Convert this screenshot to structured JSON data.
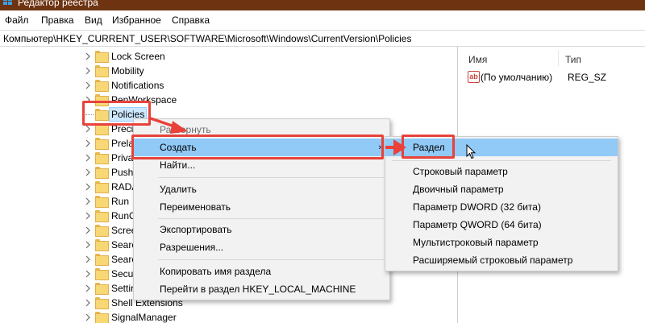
{
  "window": {
    "title": "Редактор реестра"
  },
  "menubar": {
    "items": [
      "Файл",
      "Правка",
      "Вид",
      "Избранное",
      "Справка"
    ]
  },
  "address": {
    "path": "Компьютер\\HKEY_CURRENT_USER\\SOFTWARE\\Microsoft\\Windows\\CurrentVersion\\Policies"
  },
  "tree": {
    "items": [
      {
        "label": "Lock Screen"
      },
      {
        "label": "Mobility"
      },
      {
        "label": "Notifications"
      },
      {
        "label": "PenWorkspace"
      },
      {
        "label": "Policies"
      },
      {
        "label": "Preci"
      },
      {
        "label": "Prela"
      },
      {
        "label": "Priva"
      },
      {
        "label": "Push"
      },
      {
        "label": "RADA"
      },
      {
        "label": "Run"
      },
      {
        "label": "RunO"
      },
      {
        "label": "Scree"
      },
      {
        "label": "Searc"
      },
      {
        "label": "Searc"
      },
      {
        "label": "Secu"
      },
      {
        "label": "Settir"
      },
      {
        "label": "Shell Extensions"
      },
      {
        "label": "SignalManager"
      }
    ]
  },
  "values_pane": {
    "columns": {
      "name": "Имя",
      "type": "Тип"
    },
    "rows": [
      {
        "icon": "ab",
        "name": "(По умолчанию)",
        "type": "REG_SZ"
      }
    ]
  },
  "context_menu": {
    "items": [
      {
        "label": "Развернуть"
      },
      {
        "label": "Создать",
        "arrow": "›"
      },
      {
        "label": "Найти..."
      },
      {
        "label": "Удалить"
      },
      {
        "label": "Переименовать"
      },
      {
        "label": "Экспортировать"
      },
      {
        "label": "Разрешения..."
      },
      {
        "label": "Копировать имя раздела"
      },
      {
        "label": "Перейти в раздел HKEY_LOCAL_MACHINE"
      }
    ]
  },
  "submenu": {
    "items": [
      {
        "label": "Раздел"
      },
      {
        "label": "Строковый параметр"
      },
      {
        "label": "Двоичный параметр"
      },
      {
        "label": "Параметр DWORD (32 бита)"
      },
      {
        "label": "Параметр QWORD (64 бита)"
      },
      {
        "label": "Мультистроковый параметр"
      },
      {
        "label": "Расширяемый строковый параметр"
      }
    ]
  },
  "colors": {
    "titlebar": "#6e3412",
    "highlight": "#91c9f7",
    "annotation": "#e8423a",
    "folder": "#f8d775"
  }
}
